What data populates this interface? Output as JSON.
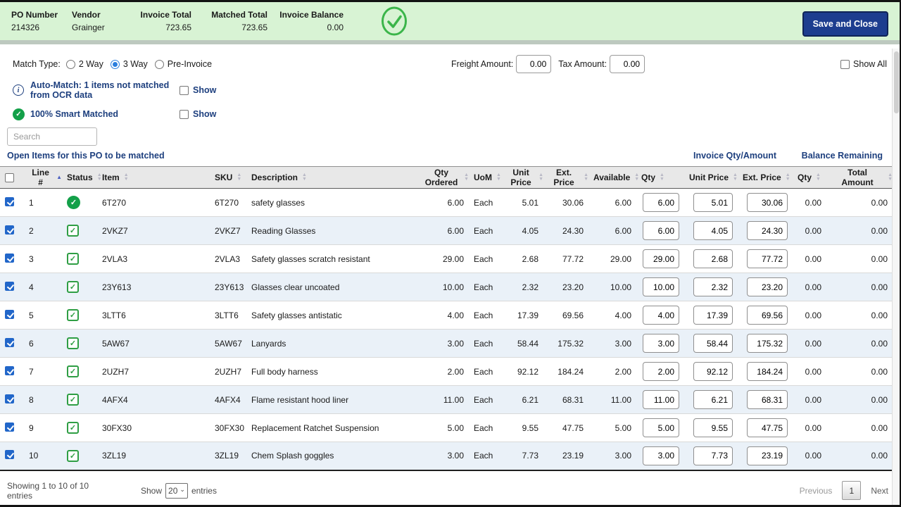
{
  "colors": {
    "bar_green": "#d8f3d4",
    "accent_green": "#3bb54a",
    "status_green": "#13a049",
    "navy_button": "#1d3d8f",
    "link_blue": "#1d3f7e",
    "row_stripe": "#eaf1f8",
    "checkbox_blue": "#2166c9"
  },
  "icons": {
    "check": "✓",
    "info": "i",
    "sort_asc": "▲",
    "sort_desc": "▼",
    "caret": "⌄"
  },
  "header": {
    "fields": [
      {
        "label": "PO Number",
        "value": "214326"
      },
      {
        "label": "Vendor",
        "value": "Grainger"
      },
      {
        "label": "Invoice Total",
        "value": "723.65"
      },
      {
        "label": "Matched Total",
        "value": "723.65"
      },
      {
        "label": "Invoice Balance",
        "value": "0.00"
      }
    ],
    "save_button": "Save and Close"
  },
  "controls": {
    "match_type_label": "Match Type:",
    "match_options": [
      {
        "label": "2 Way",
        "selected": false
      },
      {
        "label": "3 Way",
        "selected": true
      },
      {
        "label": "Pre-Invoice",
        "selected": false
      }
    ],
    "freight_label": "Freight Amount:",
    "freight_value": "0.00",
    "tax_label": "Tax Amount:",
    "tax_value": "0.00",
    "show_all_label": "Show All"
  },
  "notices": {
    "automatch_text": "Auto-Match: 1 items not matched from OCR data",
    "automatch_show_label": "Show",
    "smart_text": "100% Smart Matched",
    "smart_show_label": "Show"
  },
  "search": {
    "placeholder": "Search"
  },
  "table": {
    "caption": "Open Items for this PO to be matched",
    "invoice_group_label": "Invoice Qty/Amount",
    "balance_group_label": "Balance Remaining",
    "columns": [
      "Line #",
      "Status",
      "Item",
      "SKU",
      "Description",
      "Qty Ordered",
      "UoM",
      "Unit Price",
      "Ext. Price",
      "Available",
      "Qty",
      "Unit Price",
      "Ext. Price",
      "Qty",
      "Total Amount"
    ],
    "rows": [
      {
        "line": "1",
        "status": "circle-check",
        "item": "6T270",
        "sku": "6T270",
        "desc": "safety glasses",
        "qty_ordered": "6.00",
        "uom": "Each",
        "unit_price": "5.01",
        "ext_price": "30.06",
        "available": "6.00",
        "inv_qty": "6.00",
        "inv_unit_price": "5.01",
        "inv_ext_price": "30.06",
        "bal_qty": "0.00",
        "bal_total": "0.00"
      },
      {
        "line": "2",
        "status": "square-check",
        "item": "2VKZ7",
        "sku": "2VKZ7",
        "desc": "Reading Glasses",
        "qty_ordered": "6.00",
        "uom": "Each",
        "unit_price": "4.05",
        "ext_price": "24.30",
        "available": "6.00",
        "inv_qty": "6.00",
        "inv_unit_price": "4.05",
        "inv_ext_price": "24.30",
        "bal_qty": "0.00",
        "bal_total": "0.00"
      },
      {
        "line": "3",
        "status": "square-check",
        "item": "2VLA3",
        "sku": "2VLA3",
        "desc": "Safety glasses scratch resistant",
        "qty_ordered": "29.00",
        "uom": "Each",
        "unit_price": "2.68",
        "ext_price": "77.72",
        "available": "29.00",
        "inv_qty": "29.00",
        "inv_unit_price": "2.68",
        "inv_ext_price": "77.72",
        "bal_qty": "0.00",
        "bal_total": "0.00"
      },
      {
        "line": "4",
        "status": "square-check",
        "item": "23Y613",
        "sku": "23Y613",
        "desc": "Glasses clear uncoated",
        "qty_ordered": "10.00",
        "uom": "Each",
        "unit_price": "2.32",
        "ext_price": "23.20",
        "available": "10.00",
        "inv_qty": "10.00",
        "inv_unit_price": "2.32",
        "inv_ext_price": "23.20",
        "bal_qty": "0.00",
        "bal_total": "0.00"
      },
      {
        "line": "5",
        "status": "square-check",
        "item": "3LTT6",
        "sku": "3LTT6",
        "desc": "Safety glasses antistatic",
        "qty_ordered": "4.00",
        "uom": "Each",
        "unit_price": "17.39",
        "ext_price": "69.56",
        "available": "4.00",
        "inv_qty": "4.00",
        "inv_unit_price": "17.39",
        "inv_ext_price": "69.56",
        "bal_qty": "0.00",
        "bal_total": "0.00"
      },
      {
        "line": "6",
        "status": "square-check",
        "item": "5AW67",
        "sku": "5AW67",
        "desc": "Lanyards",
        "qty_ordered": "3.00",
        "uom": "Each",
        "unit_price": "58.44",
        "ext_price": "175.32",
        "available": "3.00",
        "inv_qty": "3.00",
        "inv_unit_price": "58.44",
        "inv_ext_price": "175.32",
        "bal_qty": "0.00",
        "bal_total": "0.00"
      },
      {
        "line": "7",
        "status": "square-check",
        "item": "2UZH7",
        "sku": "2UZH7",
        "desc": "Full body harness",
        "qty_ordered": "2.00",
        "uom": "Each",
        "unit_price": "92.12",
        "ext_price": "184.24",
        "available": "2.00",
        "inv_qty": "2.00",
        "inv_unit_price": "92.12",
        "inv_ext_price": "184.24",
        "bal_qty": "0.00",
        "bal_total": "0.00"
      },
      {
        "line": "8",
        "status": "square-check",
        "item": "4AFX4",
        "sku": "4AFX4",
        "desc": "Flame resistant hood liner",
        "qty_ordered": "11.00",
        "uom": "Each",
        "unit_price": "6.21",
        "ext_price": "68.31",
        "available": "11.00",
        "inv_qty": "11.00",
        "inv_unit_price": "6.21",
        "inv_ext_price": "68.31",
        "bal_qty": "0.00",
        "bal_total": "0.00"
      },
      {
        "line": "9",
        "status": "square-check",
        "item": "30FX30",
        "sku": "30FX30",
        "desc": "Replacement Ratchet Suspension",
        "qty_ordered": "5.00",
        "uom": "Each",
        "unit_price": "9.55",
        "ext_price": "47.75",
        "available": "5.00",
        "inv_qty": "5.00",
        "inv_unit_price": "9.55",
        "inv_ext_price": "47.75",
        "bal_qty": "0.00",
        "bal_total": "0.00"
      },
      {
        "line": "10",
        "status": "square-check",
        "item": "3ZL19",
        "sku": "3ZL19",
        "desc": "Chem Splash goggles",
        "qty_ordered": "3.00",
        "uom": "Each",
        "unit_price": "7.73",
        "ext_price": "23.19",
        "available": "3.00",
        "inv_qty": "3.00",
        "inv_unit_price": "7.73",
        "inv_ext_price": "23.19",
        "bal_qty": "0.00",
        "bal_total": "0.00"
      }
    ]
  },
  "footer": {
    "showing_text": "Showing 1 to 10 of 10 entries",
    "show_label": "Show",
    "page_size": "20",
    "entries_label": "entries",
    "previous_label": "Previous",
    "page_number": "1",
    "next_label": "Next"
  }
}
